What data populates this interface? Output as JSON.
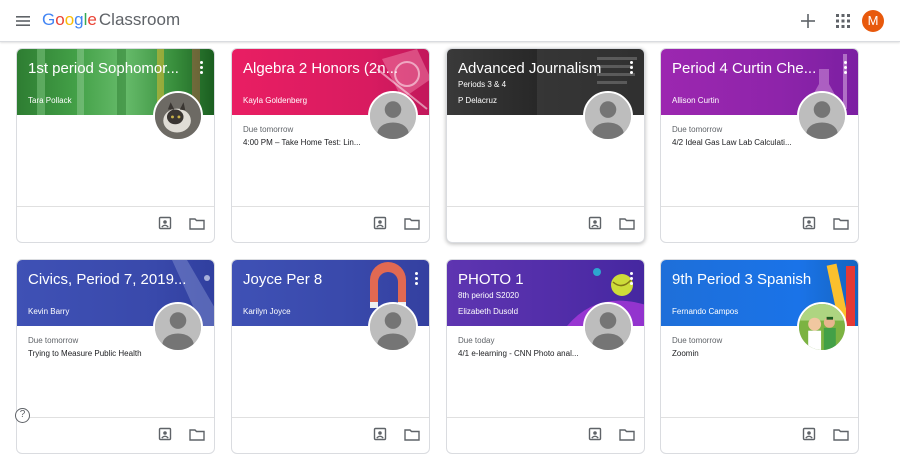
{
  "app": {
    "brand_letters": [
      "G",
      "o",
      "o",
      "g",
      "l",
      "e"
    ],
    "product": "Classroom",
    "avatar_initial": "M"
  },
  "icons": {
    "menu": "menu-icon",
    "add": "plus-icon",
    "apps": "apps-grid-icon",
    "help": "help-icon",
    "work": "assignment-icon",
    "folder": "folder-icon"
  },
  "help_label": "?",
  "colors": {
    "card1": "#2e7d32",
    "card2": "#e91e63",
    "card3": "#2b2b2b",
    "card4": "#8e24aa",
    "card5": "#3f51b5",
    "card6": "#3949ab",
    "card7": "#5e35b1",
    "card8": "#1e6fd9",
    "avatar": "#e8590c"
  },
  "cards": [
    {
      "title": "1st period Sophomor...",
      "section": "",
      "teacher": "Tara Pollack",
      "due_label": "",
      "due_item": ""
    },
    {
      "title": "Algebra 2 Honors (2n...",
      "section": "",
      "teacher": "Kayla Goldenberg",
      "due_label": "Due tomorrow",
      "due_item": "4:00 PM – Take Home Test: Lin..."
    },
    {
      "title": "Advanced Journalism",
      "section": "Periods 3 & 4",
      "teacher": "P Delacruz",
      "due_label": "",
      "due_item": ""
    },
    {
      "title": "Period 4 Curtin Che...",
      "section": "",
      "teacher": "Allison Curtin",
      "due_label": "Due tomorrow",
      "due_item": "4/2 Ideal Gas Law Lab Calculati..."
    },
    {
      "title": "Civics, Period 7, 2019...",
      "section": "",
      "teacher": "Kevin Barry",
      "due_label": "Due tomorrow",
      "due_item": "Trying to Measure Public Health"
    },
    {
      "title": "Joyce Per 8",
      "section": "",
      "teacher": "Karilyn Joyce",
      "due_label": "",
      "due_item": ""
    },
    {
      "title": "PHOTO 1",
      "section": "8th period S2020",
      "teacher": "Elizabeth Dusold",
      "due_label": "Due today",
      "due_item": "4/1 e-learning - CNN Photo anal..."
    },
    {
      "title": "9th Period 3 Spanish",
      "section": "",
      "teacher": "Fernando Campos",
      "due_label": "Due tomorrow",
      "due_item": "Zoomin"
    }
  ]
}
